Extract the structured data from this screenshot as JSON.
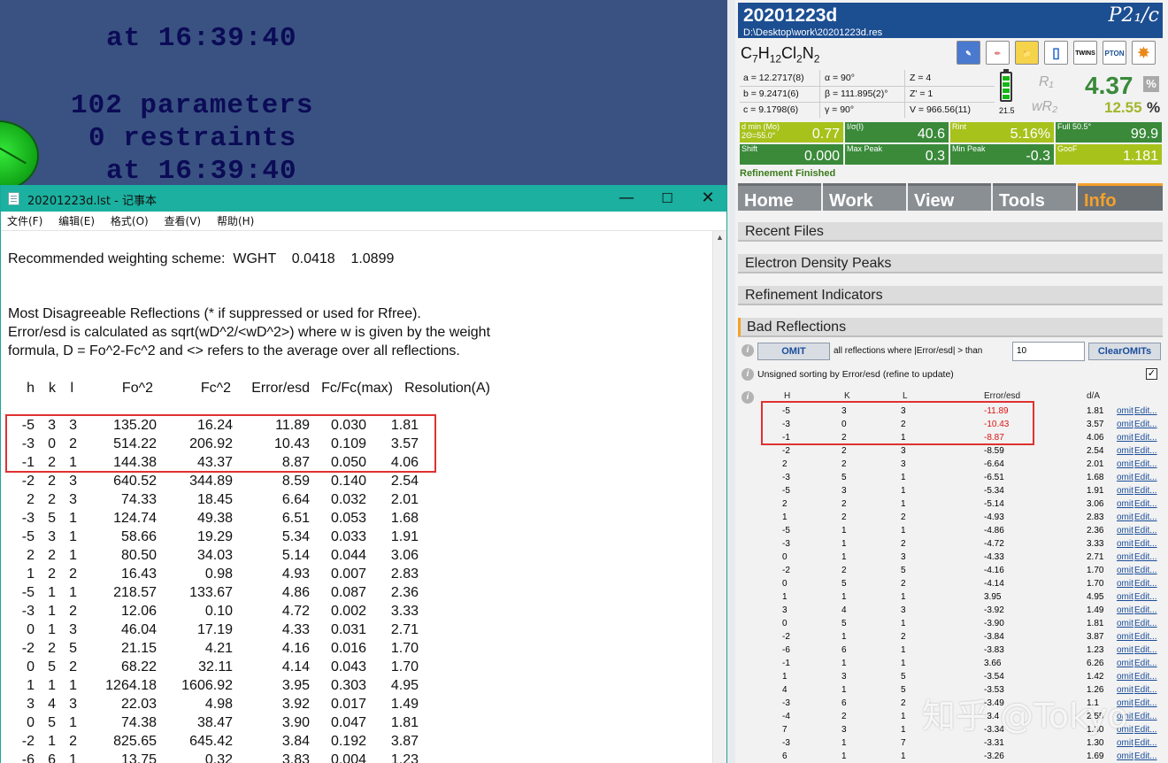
{
  "console": {
    "lines": [
      "at 16:39:40",
      "102 parameters",
      "0 restraints",
      "at 16:39:40"
    ]
  },
  "notepad": {
    "title": "20201223d.lst - 记事本",
    "window_buttons": [
      "—",
      "☐",
      "✕"
    ],
    "menu": [
      "文件(F)",
      "编辑(E)",
      "格式(O)",
      "查看(V)",
      "帮助(H)"
    ],
    "weighting_line": "Recommended weighting scheme:  WGHT    0.0418    1.0899",
    "intro_lines": [
      "Most Disagreeable Reflections (* if suppressed or used for Rfree).",
      "Error/esd is calculated as sqrt(wD^2/<wD^2>) where w is given by the weight",
      "formula, D = Fo^2-Fc^2 and <> refers to the average over all reflections."
    ],
    "headers": [
      "h",
      "k",
      "l",
      "Fo^2",
      "Fc^2",
      "Error/esd",
      "Fc/Fc(max)",
      "Resolution(A)"
    ],
    "rows": [
      [
        "-5",
        "3",
        "3",
        "135.20",
        "16.24",
        "11.89",
        "0.030",
        "1.81"
      ],
      [
        "-3",
        "0",
        "2",
        "514.22",
        "206.92",
        "10.43",
        "0.109",
        "3.57"
      ],
      [
        "-1",
        "2",
        "1",
        "144.38",
        "43.37",
        "8.87",
        "0.050",
        "4.06"
      ],
      [
        "-2",
        "2",
        "3",
        "640.52",
        "344.89",
        "8.59",
        "0.140",
        "2.54"
      ],
      [
        "2",
        "2",
        "3",
        "74.33",
        "18.45",
        "6.64",
        "0.032",
        "2.01"
      ],
      [
        "-3",
        "5",
        "1",
        "124.74",
        "49.38",
        "6.51",
        "0.053",
        "1.68"
      ],
      [
        "-5",
        "3",
        "1",
        "58.66",
        "19.29",
        "5.34",
        "0.033",
        "1.91"
      ],
      [
        "2",
        "2",
        "1",
        "80.50",
        "34.03",
        "5.14",
        "0.044",
        "3.06"
      ],
      [
        "1",
        "2",
        "2",
        "16.43",
        "0.98",
        "4.93",
        "0.007",
        "2.83"
      ],
      [
        "-5",
        "1",
        "1",
        "218.57",
        "133.67",
        "4.86",
        "0.087",
        "2.36"
      ],
      [
        "-3",
        "1",
        "2",
        "12.06",
        "0.10",
        "4.72",
        "0.002",
        "3.33"
      ],
      [
        "0",
        "1",
        "3",
        "46.04",
        "17.19",
        "4.33",
        "0.031",
        "2.71"
      ],
      [
        "-2",
        "2",
        "5",
        "21.15",
        "4.21",
        "4.16",
        "0.016",
        "1.70"
      ],
      [
        "0",
        "5",
        "2",
        "68.22",
        "32.11",
        "4.14",
        "0.043",
        "1.70"
      ],
      [
        "1",
        "1",
        "1",
        "1264.18",
        "1606.92",
        "3.95",
        "0.303",
        "4.95"
      ],
      [
        "3",
        "4",
        "3",
        "22.03",
        "4.98",
        "3.92",
        "0.017",
        "1.49"
      ],
      [
        "0",
        "5",
        "1",
        "74.38",
        "38.47",
        "3.90",
        "0.047",
        "1.81"
      ],
      [
        "-2",
        "1",
        "2",
        "825.65",
        "645.42",
        "3.84",
        "0.192",
        "3.87"
      ],
      [
        "-6",
        "6",
        "1",
        "13.75",
        "0.32",
        "3.83",
        "0.004",
        "1.23"
      ]
    ]
  },
  "panel": {
    "name": "20201223d",
    "path": "D:\\Desktop\\work\\20201223d.res",
    "space_group": "P2₁/c",
    "formula": {
      "parts": [
        [
          "C",
          "7"
        ],
        [
          "H",
          "12"
        ],
        [
          "Cl",
          "2"
        ],
        [
          "N",
          "2"
        ]
      ]
    },
    "toolbar": [
      "✎",
      "✏",
      "📁",
      "▯",
      "TWINS",
      "PTON",
      "✸"
    ],
    "cell": [
      [
        "a = 12.2717(8)",
        "α = 90°",
        "Z = 4"
      ],
      [
        "b = 9.2471(6)",
        "β = 111.895(2)°",
        "Z' = 1"
      ],
      [
        "c = 9.1798(6)",
        "γ = 90°",
        "V = 966.56(11)"
      ]
    ],
    "battery_value": "21.5",
    "r1_label": "R₁",
    "wr2_label": "wR₂",
    "r1": "4.37",
    "wr2": "12.55",
    "pct1": "%",
    "pct2": "%",
    "stats": [
      {
        "label": "d min (Mo)\n2Θ=55.0°",
        "value": "0.77",
        "color": "#a8c21c"
      },
      {
        "label": "I/σ(I)",
        "value": "40.6",
        "color": "#3a8a3a"
      },
      {
        "label": "Rint",
        "value": "5.16%",
        "color": "#a8c21c"
      },
      {
        "label": "Full 50.5°",
        "value": "99.9",
        "color": "#3a8a3a"
      },
      {
        "label": "Shift",
        "value": "0.000",
        "color": "#3a8a3a"
      },
      {
        "label": "Max Peak",
        "value": "0.3",
        "color": "#3a8a3a"
      },
      {
        "label": "Min Peak",
        "value": "-0.3",
        "color": "#3a8a3a"
      },
      {
        "label": "GooF",
        "value": "1.181",
        "color": "#a8c21c"
      }
    ],
    "status": "Refinement Finished",
    "tabs": [
      "Home",
      "Work",
      "View",
      "Tools",
      "Info"
    ],
    "sections": [
      "Recent Files",
      "Electron Density Peaks",
      "Refinement Indicators",
      "Bad Reflections"
    ],
    "omit_label": "OMIT",
    "omit_text": "all reflections where |Error/esd| > than",
    "threshold": "10",
    "clear_label": "ClearOMITs",
    "sort_text": "Unsigned sorting by Error/esd (refine to update)",
    "checkbox": "✓",
    "info_icon": "i",
    "table_headers": [
      "H",
      "K",
      "L",
      "Error/esd",
      "d/A"
    ],
    "omit_link": "omit",
    "edit_link": "Edit...",
    "reflections": [
      [
        "-5",
        "3",
        "3",
        "-11.89",
        "1.81",
        true
      ],
      [
        "-3",
        "0",
        "2",
        "-10.43",
        "3.57",
        true
      ],
      [
        "-1",
        "2",
        "1",
        "-8.87",
        "4.06",
        false
      ],
      [
        "-2",
        "2",
        "3",
        "-8.59",
        "2.54",
        false
      ],
      [
        "2",
        "2",
        "3",
        "-6.64",
        "2.01",
        false
      ],
      [
        "-3",
        "5",
        "1",
        "-6.51",
        "1.68",
        false
      ],
      [
        "-5",
        "3",
        "1",
        "-5.34",
        "1.91",
        false
      ],
      [
        "2",
        "2",
        "1",
        "-5.14",
        "3.06",
        false
      ],
      [
        "1",
        "2",
        "2",
        "-4.93",
        "2.83",
        false
      ],
      [
        "-5",
        "1",
        "1",
        "-4.86",
        "2.36",
        false
      ],
      [
        "-3",
        "1",
        "2",
        "-4.72",
        "3.33",
        false
      ],
      [
        "0",
        "1",
        "3",
        "-4.33",
        "2.71",
        false
      ],
      [
        "-2",
        "2",
        "5",
        "-4.16",
        "1.70",
        false
      ],
      [
        "0",
        "5",
        "2",
        "-4.14",
        "1.70",
        false
      ],
      [
        "1",
        "1",
        "1",
        "3.95",
        "4.95",
        false
      ],
      [
        "3",
        "4",
        "3",
        "-3.92",
        "1.49",
        false
      ],
      [
        "0",
        "5",
        "1",
        "-3.90",
        "1.81",
        false
      ],
      [
        "-2",
        "1",
        "2",
        "-3.84",
        "3.87",
        false
      ],
      [
        "-6",
        "6",
        "1",
        "-3.83",
        "1.23",
        false
      ],
      [
        "-1",
        "1",
        "1",
        "3.66",
        "6.26",
        false
      ],
      [
        "1",
        "3",
        "5",
        "-3.54",
        "1.42",
        false
      ],
      [
        "4",
        "1",
        "5",
        "-3.53",
        "1.26",
        false
      ],
      [
        "-3",
        "6",
        "2",
        "-3.49",
        "1.1",
        false
      ],
      [
        "-4",
        "2",
        "1",
        "-3.4",
        "2.55",
        false
      ],
      [
        "7",
        "3",
        "1",
        "-3.34",
        "1.30",
        false
      ],
      [
        "-3",
        "1",
        "7",
        "-3.31",
        "1.30",
        false
      ],
      [
        "6",
        "1",
        "1",
        "-3.26",
        "1.69",
        false
      ]
    ]
  },
  "watermark": "知乎 @Tokyo"
}
